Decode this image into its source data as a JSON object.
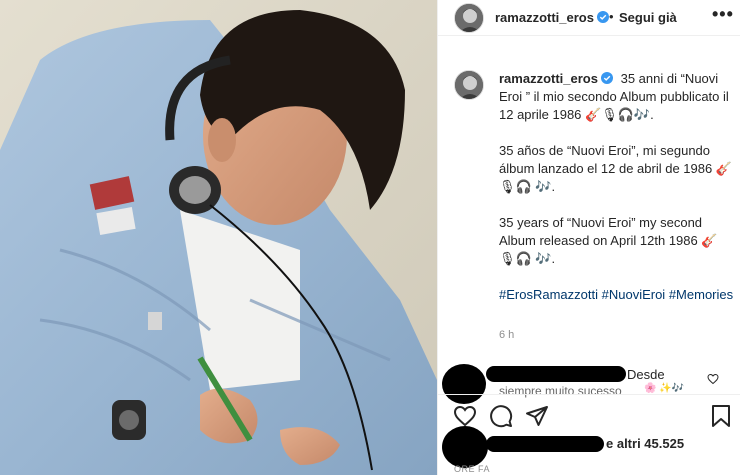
{
  "post": {
    "username": "ramazzotti_eros",
    "follow_separator": "•",
    "follow_label": "Segui già",
    "more_label": "•••"
  },
  "caption": {
    "username": "ramazzotti_eros",
    "line_it": "35 anni di “Nuovi Eroi ” il mio secondo Album pubblicato il 12 aprile 1986 🎸🎙🎧🎶.",
    "line_es": "35 años de “Nuovi Eroi”, mi segundo álbum lanzado el 12 de abril de 1986 🎸🎙🎧 🎶.",
    "line_en": "35 years of “Nuovi Eroi” my second Album released on April 12th 1986 🎸🎙🎧 🎶.",
    "hashtags": [
      "#ErosRamazzotti",
      "#NuoviEroi",
      "#Memories"
    ],
    "time_ago": "6 h"
  },
  "comment": {
    "text": "Desde",
    "text_cont": "siempre muito sucesso",
    "emoji_tail": "🌸 ✨🎶"
  },
  "likes": {
    "text": "e altri 45.525",
    "time_ago": "ORE FA"
  },
  "icons": [
    "verified-badge-icon",
    "heart-icon",
    "comment-icon",
    "share-icon",
    "bookmark-icon",
    "small-heart-icon"
  ],
  "colors": {
    "verified": "#3897f0",
    "link": "#00376b",
    "muted": "#8e8e8e",
    "text": "#262626"
  }
}
